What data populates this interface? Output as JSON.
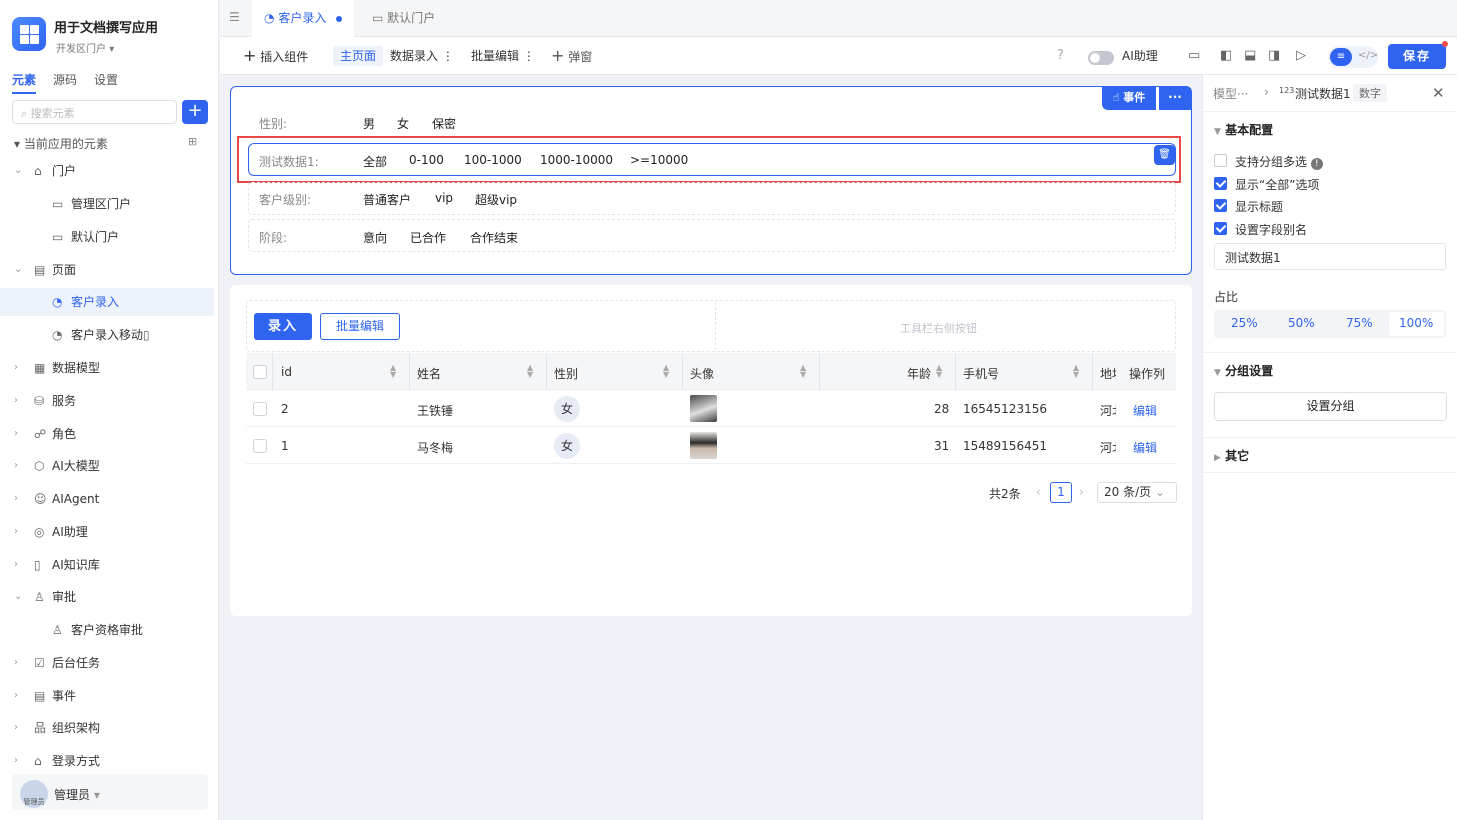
{
  "app": {
    "title": "用于文档撰写应用",
    "subtitle": "开发区门户"
  },
  "sidebar": {
    "tabs": [
      "元素",
      "源码",
      "设置"
    ],
    "search_placeholder": "搜索元素",
    "tree_header": "当前应用的元素",
    "items": [
      {
        "label": "门户"
      },
      {
        "label": "管理区门户"
      },
      {
        "label": "默认门户"
      },
      {
        "label": "页面"
      },
      {
        "label": "客户录入"
      },
      {
        "label": "客户录入移动"
      },
      {
        "label": "数据模型"
      },
      {
        "label": "服务"
      },
      {
        "label": "角色"
      },
      {
        "label": "AI大模型"
      },
      {
        "label": "AIAgent"
      },
      {
        "label": "AI助理"
      },
      {
        "label": "AI知识库"
      },
      {
        "label": "审批"
      },
      {
        "label": "客户资格审批"
      },
      {
        "label": "后台任务"
      },
      {
        "label": "事件"
      },
      {
        "label": "组织架构"
      },
      {
        "label": "登录方式"
      }
    ],
    "user": {
      "name": "管理员",
      "avatar_text": "管理员"
    }
  },
  "tabs": [
    {
      "label": "客户录入"
    },
    {
      "label": "默认门户"
    }
  ],
  "toolbar": {
    "insert": "插入组件",
    "main_page": "主页面",
    "data_entry": "数据录入",
    "batch_edit": "批量编辑",
    "popup": "弹窗",
    "ai_assistant": "AI助理",
    "save": "保存"
  },
  "filter": {
    "event_btn": "事件",
    "rows": [
      {
        "label": "性别:",
        "options": [
          "男",
          "女",
          "保密"
        ]
      },
      {
        "label": "测试数据1:",
        "options": [
          "全部",
          "0-100",
          "100-1000",
          "1000-10000",
          ">=10000"
        ]
      },
      {
        "label": "客户级别:",
        "options": [
          "普通客户",
          "vip",
          "超级vip"
        ]
      },
      {
        "label": "阶段:",
        "options": [
          "意向",
          "已合作",
          "合作结束"
        ]
      }
    ]
  },
  "table": {
    "btn_entry": "录入",
    "btn_batch": "批量编辑",
    "toolbar_right": "工具栏右侧按钮",
    "columns": [
      "id",
      "姓名",
      "性别",
      "头像",
      "年龄",
      "手机号",
      "地址",
      "操作列"
    ],
    "rows": [
      {
        "id": "2",
        "name": "王铁锤",
        "sex": "女",
        "age": "28",
        "phone": "16545123156",
        "addr": "河北",
        "op": "编辑"
      },
      {
        "id": "1",
        "name": "马冬梅",
        "sex": "女",
        "age": "31",
        "phone": "15489156451",
        "addr": "河北",
        "op": "编辑"
      }
    ],
    "total": "共2条",
    "page": "1",
    "page_size": "20 条/页"
  },
  "panel": {
    "breadcrumb_parent": "模型···",
    "breadcrumb_current": "测试数据1",
    "type_badge": "数字",
    "basic_title": "基本配置",
    "checks": [
      {
        "label": "支持分组多选",
        "checked": false
      },
      {
        "label": "显示“全部”选项",
        "checked": true
      },
      {
        "label": "显示标题",
        "checked": true
      },
      {
        "label": "设置字段别名",
        "checked": true
      }
    ],
    "alias_value": "测试数据1",
    "ratio_title": "占比",
    "ratios": [
      "25%",
      "50%",
      "75%",
      "100%"
    ],
    "group_title": "分组设置",
    "group_btn": "设置分组",
    "other_title": "其它"
  },
  "colors": {
    "primary": "#2f64f0",
    "highlight": "#e84848"
  }
}
